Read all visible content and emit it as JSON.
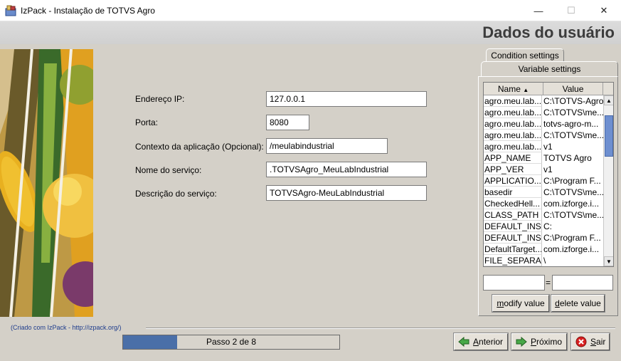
{
  "window": {
    "title": "IzPack - Instalação de TOTVS Agro",
    "minimize_icon": "minimize-icon",
    "maximize_icon": "maximize-icon",
    "close_icon": "close-icon"
  },
  "header": {
    "title": "Dados do usuário"
  },
  "form": {
    "fields": [
      {
        "label": "Endereço IP:",
        "value": "127.0.0.1"
      },
      {
        "label": "Porta:",
        "value": "8080"
      },
      {
        "label": "Contexto da aplicação (Opcional):",
        "value": "/meulabindustrial"
      },
      {
        "label": "Nome do serviço:",
        "value": ".TOTVSAgro_MeuLabIndustrial"
      },
      {
        "label": "Descrição do serviço:",
        "value": "TOTVSAgro-MeuLabIndustrial"
      }
    ]
  },
  "panel": {
    "tabs": [
      "Condition settings",
      "Variable settings"
    ],
    "active_tab": "Variable settings",
    "columns": [
      "Name",
      "Value"
    ],
    "sort_icon": "sort-ascending-icon",
    "rows": [
      {
        "name": "agro.meu.lab...",
        "value": "C:\\TOTVS-Agro"
      },
      {
        "name": "agro.meu.lab...",
        "value": "C:\\TOTVS\\me..."
      },
      {
        "name": "agro.meu.lab...",
        "value": "totvs-agro-m..."
      },
      {
        "name": "agro.meu.lab...",
        "value": "C:\\TOTVS\\me..."
      },
      {
        "name": "agro.meu.lab...",
        "value": "v1"
      },
      {
        "name": "APP_NAME",
        "value": "TOTVS Agro"
      },
      {
        "name": "APP_VER",
        "value": "v1"
      },
      {
        "name": "APPLICATIO...",
        "value": "C:\\Program F..."
      },
      {
        "name": "basedir",
        "value": "C:\\TOTVS\\me..."
      },
      {
        "name": "CheckedHell...",
        "value": "com.izforge.i..."
      },
      {
        "name": "CLASS_PATH",
        "value": "C:\\TOTVS\\me..."
      },
      {
        "name": "DEFAULT_INS...",
        "value": "C:"
      },
      {
        "name": "DEFAULT_INS...",
        "value": "C:\\Program F..."
      },
      {
        "name": "DefaultTarget...",
        "value": "com.izforge.i..."
      },
      {
        "name": "FILE_SEPARA...",
        "value": "\\"
      }
    ],
    "edit_name_value": "",
    "edit_value_value": "",
    "equals": "=",
    "modify_button": {
      "prefix": "",
      "mnemonic": "m",
      "rest": "odify value"
    },
    "delete_button": {
      "prefix": "",
      "mnemonic": "d",
      "rest": "elete value"
    }
  },
  "footer": {
    "credit": "(Criado com IzPack - http://izpack.org/)",
    "progress_text": "Passo 2 de 8",
    "progress_fraction": 0.25,
    "buttons": [
      {
        "mnemonic": "A",
        "rest": "nterior",
        "icon": "arrow-left-icon"
      },
      {
        "mnemonic": "P",
        "rest": "róximo",
        "icon": "arrow-right-icon"
      },
      {
        "mnemonic": "S",
        "rest": "air",
        "icon": "cancel-icon"
      }
    ]
  },
  "colors": {
    "background": "#d4d0c8",
    "heading": "#3c3c3c",
    "progress_fill": "#4a6fa8",
    "credit_link": "#1e3c8c"
  }
}
